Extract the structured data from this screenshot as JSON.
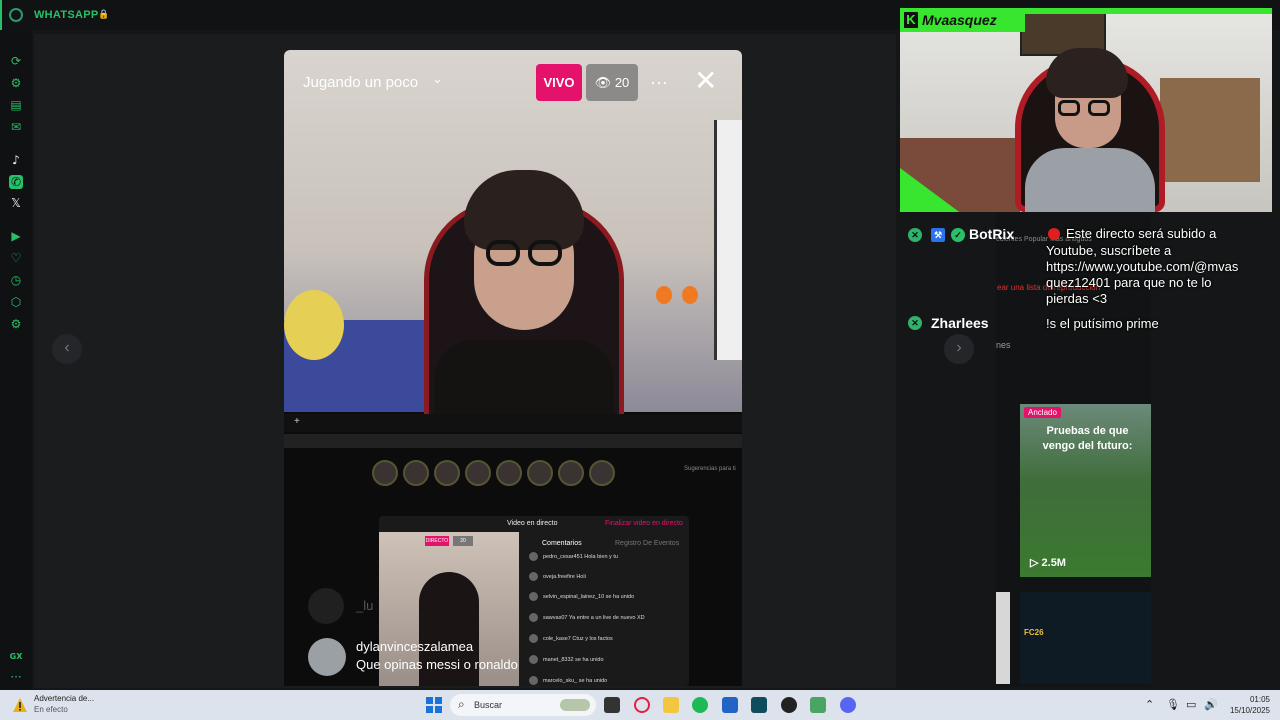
{
  "app": {
    "title": "WHATSAPP",
    "lock_icon": "lock-icon"
  },
  "sidebar": {
    "items": [
      {
        "icon": "refresh-icon",
        "glyph": "⟳"
      },
      {
        "icon": "chatgpt-icon",
        "glyph": "⚙"
      },
      {
        "icon": "notes-icon",
        "glyph": "▤"
      },
      {
        "icon": "messenger-icon",
        "glyph": "✉"
      },
      {
        "icon": "tiktok-icon",
        "glyph": "♪"
      },
      {
        "icon": "whatsapp-icon",
        "glyph": "✆"
      },
      {
        "icon": "x-twitter-icon",
        "glyph": "𝕏"
      },
      {
        "icon": "player-icon",
        "glyph": "▶"
      },
      {
        "icon": "heart-icon",
        "glyph": "♡"
      },
      {
        "icon": "history-icon",
        "glyph": "◷"
      },
      {
        "icon": "extensions-icon",
        "glyph": "⬡"
      },
      {
        "icon": "settings-icon",
        "glyph": "⚙"
      }
    ],
    "gx_label": "GX",
    "more": "···"
  },
  "story": {
    "title": "Jugando un poco",
    "chevron": "⌄",
    "live_badge": "VIVO",
    "viewers": "20",
    "more": "···",
    "close": "✕",
    "progress_plus": "+",
    "comment_user": "dylanvinceszalamea",
    "comment_text": "Que opinas messi o ronaldo",
    "ghost_user": "_lu",
    "nav_prev": "‹",
    "nav_next": "›",
    "inner": {
      "header": "Video en directo",
      "finish": "Finalizar video en directo",
      "badge_live": "DIRECTO",
      "badge_count": "20",
      "tab_comments": "Comentarios",
      "tab_events": "Registro De Eventos",
      "suggest": "Sugerencias para ti",
      "comments": [
        "pedro_cesar451 Hola bien y tu",
        "oveja.freefire Holi",
        "selvin_espinal_lainez_10 se ha unido",
        "sawvas07 Ya entre a un live de nuevo XD",
        "cole_kase7 Ctuz y los factos",
        "manet_8332 se ha unido",
        "marcelo_sku_ se ha unido"
      ]
    }
  },
  "stream": {
    "streamer": "Mvaasquez",
    "k_logo": "K",
    "botrix_name": "BotRix",
    "botrix_msg": "Este directo será subido a Youtube, suscríbete a https://www.youtube.com/@mvasquez12401 para que no te lo pierdas <3",
    "botrix_lines": [
      "Este directo será subido a",
      "Youtube, suscríbete a",
      "https://www.youtube.com/@mvas",
      "quez12401 para que no te lo",
      "pierdas <3"
    ],
    "zharlees_name": "Zharlees",
    "zharlees_msg": "!s el putísimo prime",
    "bg_tabs": "ecientes   Popular   Más antiguos",
    "bg_link": "ear una lista de reproducción",
    "bg_ones": "nes"
  },
  "cards": {
    "pinned_label": "Anclado",
    "pinned_title": "Pruebas de que vengo del futuro:",
    "pinned_plays": "▷ 2.5M",
    "card2_text": "FC26"
  },
  "taskbar": {
    "warning_title": "Advertencia de...",
    "warning_sub": "En efecto",
    "search": "Buscar",
    "time": "01:05",
    "date": "15/10/2025"
  }
}
